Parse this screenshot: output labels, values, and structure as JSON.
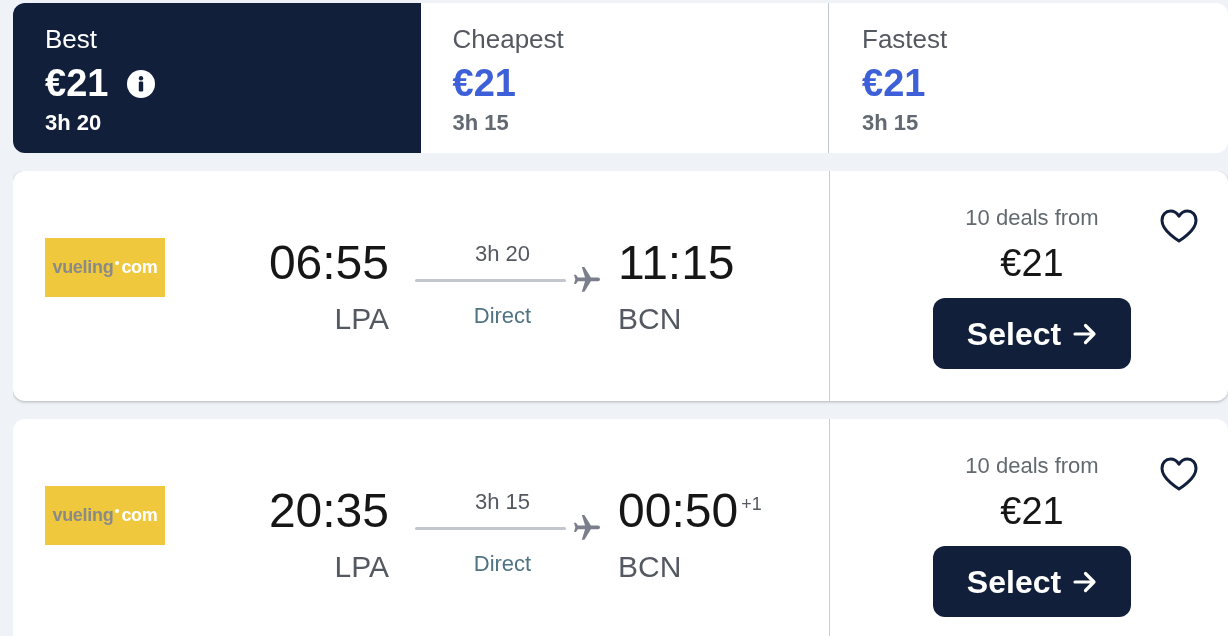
{
  "sort_tabs": [
    {
      "label": "Best",
      "price": "€21",
      "duration": "3h 20",
      "selected": true,
      "info": true
    },
    {
      "label": "Cheapest",
      "price": "€21",
      "duration": "3h 15",
      "selected": false,
      "info": false
    },
    {
      "label": "Fastest",
      "price": "€21",
      "duration": "3h 15",
      "selected": false,
      "info": false
    }
  ],
  "flights": [
    {
      "airline_logo": {
        "name": "vueling",
        "suffix": "com"
      },
      "depart_time": "06:55",
      "depart_airport": "LPA",
      "duration": "3h 20",
      "stops": "Direct",
      "arrive_time": "11:15",
      "arrive_airport": "BCN",
      "deals": "10 deals from",
      "price": "€21",
      "select_label": "Select",
      "saved": false
    },
    {
      "airline_logo": {
        "name": "vueling",
        "suffix": "com"
      },
      "depart_time": "20:35",
      "depart_airport": "LPA",
      "duration": "3h 15",
      "stops": "Direct",
      "arrive_time": "00:50",
      "arrive_day_offset": "+1",
      "arrive_airport": "BCN",
      "deals": "10 deals from",
      "price": "€21",
      "select_label": "Select",
      "saved": false
    }
  ]
}
